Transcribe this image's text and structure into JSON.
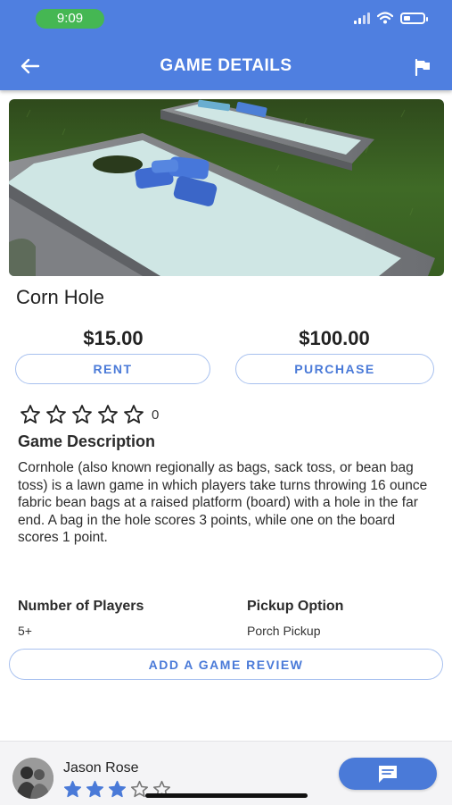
{
  "status_bar": {
    "time": "9:09",
    "signal_bars": 2,
    "battery_level": 0.35
  },
  "header": {
    "title": "GAME DETAILS",
    "back_icon": "arrow-left-icon",
    "flag_icon": "flag-icon",
    "background_color": "#4f7fe0"
  },
  "game": {
    "name": "Corn Hole",
    "rent_price": "$15.00",
    "purchase_price": "$100.00",
    "rent_label": "RENT",
    "purchase_label": "PURCHASE",
    "rating": 0,
    "rating_max": 5,
    "rating_count": "0",
    "description_title": "Game Description",
    "description": "Cornhole (also known regionally as bags, sack toss, or bean bag toss) is a lawn game in which players take turns throwing 16 ounce fabric bean bags at a raised platform (board) with a hole in the far end. A bag in the hole scores 3 points, while one on the board scores 1 point.",
    "players_label": "Number of Players",
    "players_value": "5+",
    "pickup_label": "Pickup Option",
    "pickup_value": "Porch Pickup",
    "review_button_label": "ADD A GAME REVIEW"
  },
  "owner": {
    "name": "Jason Rose",
    "rating": 3,
    "rating_max": 5,
    "chat_icon": "chat-icon"
  },
  "colors": {
    "accent": "#4a7ad8",
    "status_green": "#45b753"
  }
}
